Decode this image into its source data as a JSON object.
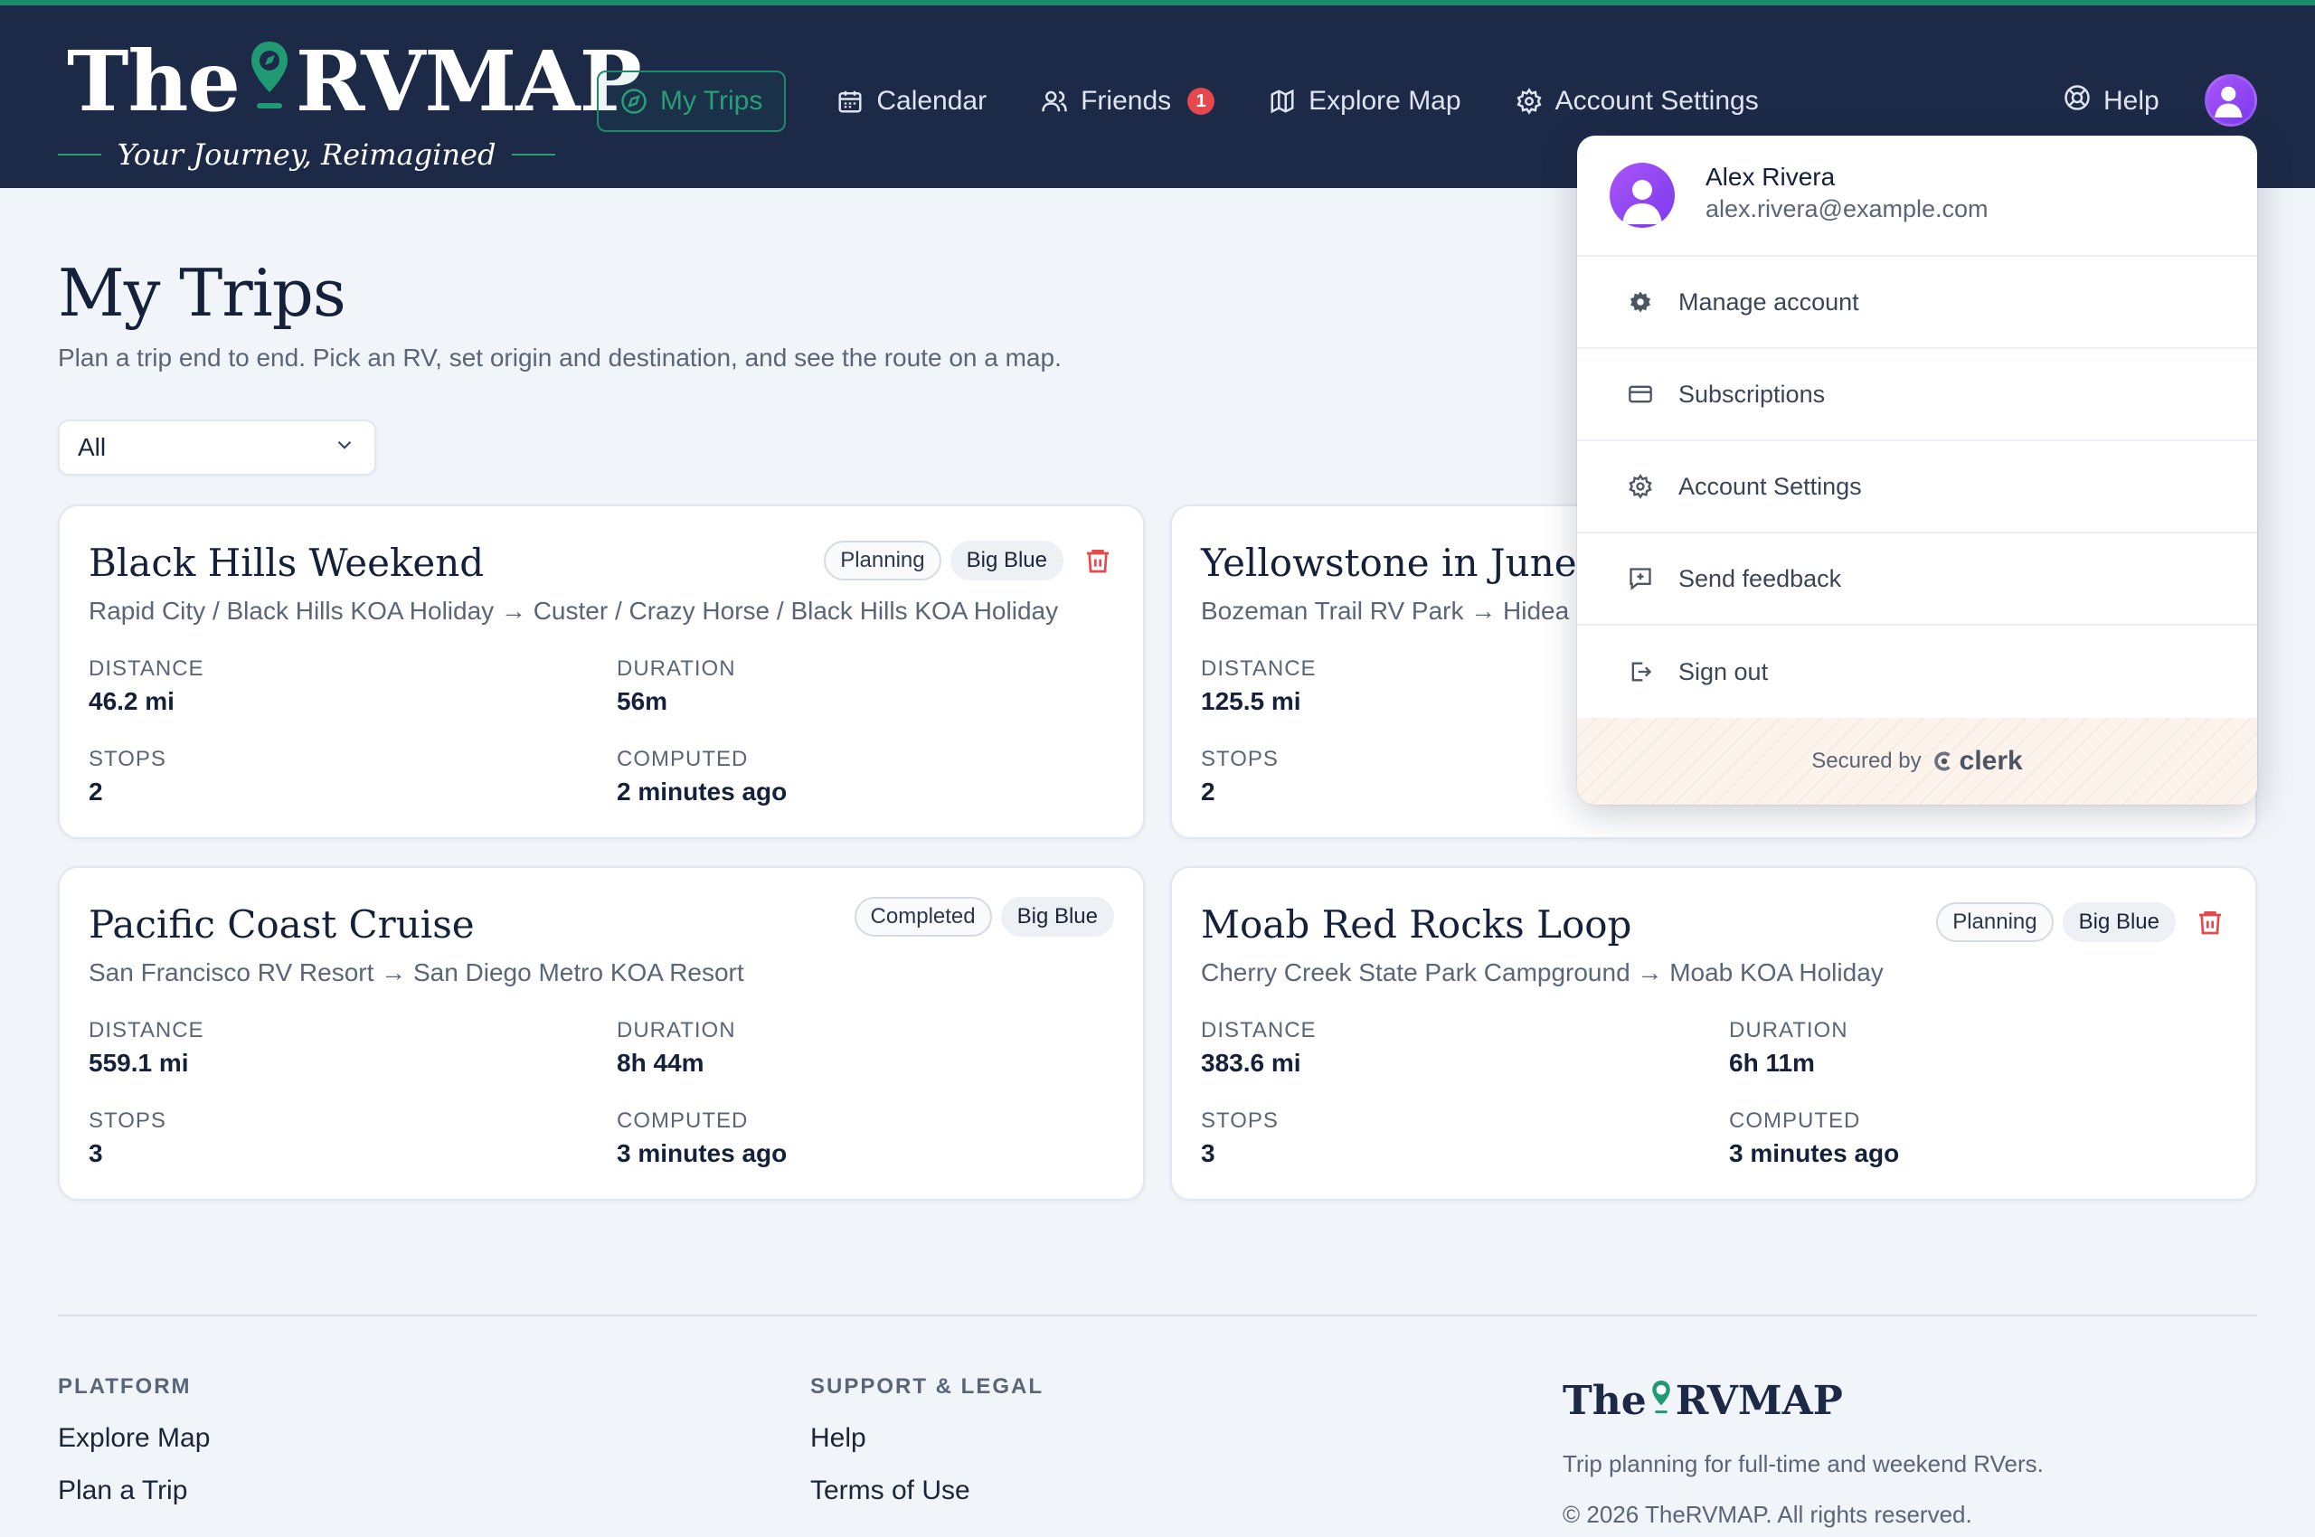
{
  "brand": {
    "name_left": "The",
    "name_right": "RVMAP",
    "tagline": "Your Journey, Reimagined"
  },
  "nav": {
    "items": [
      {
        "label": "My Trips",
        "icon": "compass-icon",
        "active": true
      },
      {
        "label": "Calendar",
        "icon": "calendar-icon"
      },
      {
        "label": "Friends",
        "icon": "users-icon",
        "badge": "1"
      },
      {
        "label": "Explore Map",
        "icon": "map-icon"
      },
      {
        "label": "Account Settings",
        "icon": "gear-icon"
      }
    ],
    "help_label": "Help"
  },
  "page": {
    "title": "My Trips",
    "subtitle": "Plan a trip end to end. Pick an RV, set origin and destination, and see the route on a map.",
    "filter_value": "All"
  },
  "labels": {
    "distance": "DISTANCE",
    "duration": "DURATION",
    "stops": "STOPS",
    "computed": "COMPUTED"
  },
  "trips": [
    {
      "title": "Black Hills Weekend",
      "route": "Rapid City / Black Hills KOA Holiday → Custer / Crazy Horse / Black Hills KOA Holiday",
      "status": "Planning",
      "rv": "Big Blue",
      "distance": "46.2 mi",
      "duration": "56m",
      "stops": "2",
      "computed": "2 minutes ago"
    },
    {
      "title": "Yellowstone in June",
      "route": "Bozeman Trail RV Park → Hidea",
      "distance": "125.5 mi",
      "stops": "2"
    },
    {
      "title": "Pacific Coast Cruise",
      "route": "San Francisco RV Resort → San Diego Metro KOA Resort",
      "status": "Completed",
      "rv": "Big Blue",
      "distance": "559.1 mi",
      "duration": "8h 44m",
      "stops": "3",
      "computed": "3 minutes ago"
    },
    {
      "title": "Moab Red Rocks Loop",
      "route": "Cherry Creek State Park Campground → Moab KOA Holiday",
      "status": "Planning",
      "rv": "Big Blue",
      "distance": "383.6 mi",
      "duration": "6h 11m",
      "stops": "3",
      "computed": "3 minutes ago"
    }
  ],
  "footer": {
    "platform_heading": "PLATFORM",
    "platform_links": [
      "Explore Map",
      "Plan a Trip"
    ],
    "support_heading": "SUPPORT & LEGAL",
    "support_links": [
      "Help",
      "Terms of Use"
    ],
    "description": "Trip planning for full-time and weekend RVers.",
    "copyright": "© 2026 TheRVMAP. All rights reserved."
  },
  "user_menu": {
    "name": "Alex Rivera",
    "email": "alex.rivera@example.com",
    "items": [
      {
        "label": "Manage account",
        "icon": "cog-solid-icon"
      },
      {
        "label": "Subscriptions",
        "icon": "credit-card-icon"
      },
      {
        "label": "Account Settings",
        "icon": "gear-icon"
      },
      {
        "label": "Send feedback",
        "icon": "feedback-icon"
      },
      {
        "label": "Sign out",
        "icon": "sign-out-icon"
      }
    ],
    "secured_by": "Secured by",
    "provider": "clerk"
  },
  "colors": {
    "header_bg": "#1c2a47",
    "accent_green": "#1f8a6a",
    "danger_red": "#e5484d",
    "avatar_purple": "#8b5cf6"
  }
}
